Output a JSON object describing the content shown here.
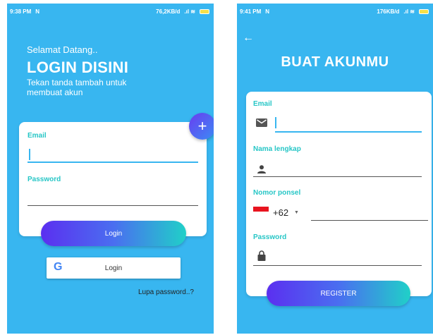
{
  "left_screen": {
    "status": {
      "time": "9:38 PM",
      "net": "76,2KB/d"
    },
    "welcome": "Selamat Datang..",
    "title": "LOGIN DISINI",
    "subtitle": "Tekan tanda tambah untuk membuat akun",
    "email_label": "Email",
    "email_value": "",
    "password_label": "Password",
    "password_value": "",
    "fab_label": "+",
    "login_label": "Login",
    "google_login_label": "Login",
    "forgot_label": "Lupa password..?"
  },
  "right_screen": {
    "status": {
      "time": "9:41 PM",
      "net": "176KB/d"
    },
    "title": "BUAT AKUNMU",
    "email_label": "Email",
    "name_label": "Nama lengkap",
    "phone_label": "Nomor ponsel",
    "country_code": "+62",
    "password_label": "Password",
    "register_label": "REGISTER"
  },
  "colors": {
    "background": "#38b6f0",
    "label": "#26c6c6",
    "gradient_start": "#5b2ff0",
    "gradient_end": "#20d0c8"
  },
  "icons": [
    "back-arrow-icon",
    "mail-icon",
    "person-icon",
    "lock-icon",
    "google-icon",
    "plus-icon",
    "indonesia-flag-icon",
    "dropdown-arrow-icon"
  ]
}
